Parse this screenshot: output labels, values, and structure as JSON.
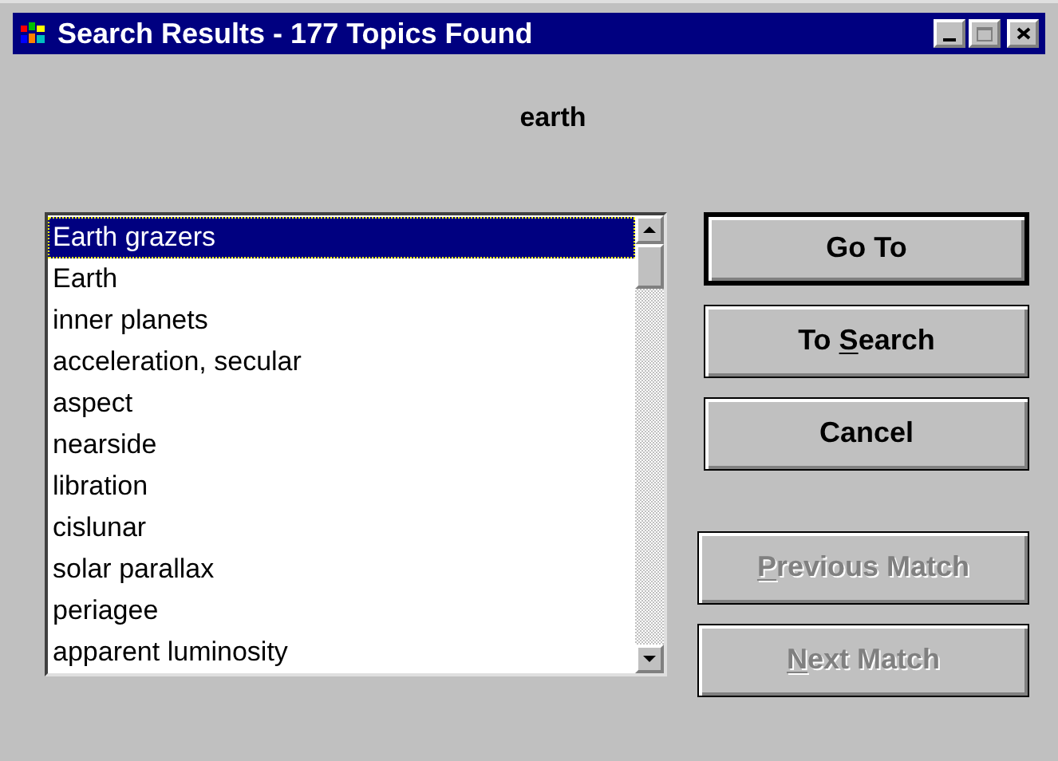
{
  "window": {
    "title": "Search Results - 177 Topics Found"
  },
  "query": "earth",
  "results": [
    {
      "label": "Earth grazers",
      "selected": true
    },
    {
      "label": "Earth",
      "selected": false
    },
    {
      "label": "inner planets",
      "selected": false
    },
    {
      "label": "acceleration, secular",
      "selected": false
    },
    {
      "label": "aspect",
      "selected": false
    },
    {
      "label": "nearside",
      "selected": false
    },
    {
      "label": "libration",
      "selected": false
    },
    {
      "label": "cislunar",
      "selected": false
    },
    {
      "label": "solar parallax",
      "selected": false
    },
    {
      "label": "periagee",
      "selected": false
    },
    {
      "label": "apparent luminosity",
      "selected": false
    }
  ],
  "buttons": [
    {
      "label_parts": [
        {
          "text": "Go To",
          "underline": false
        }
      ],
      "default": true,
      "disabled": false
    },
    {
      "label_parts": [
        {
          "text": "To ",
          "underline": false
        },
        {
          "text": "S",
          "underline": true
        },
        {
          "text": "earch",
          "underline": false
        }
      ],
      "default": false,
      "disabled": false
    },
    {
      "label_parts": [
        {
          "text": "Cancel",
          "underline": false
        }
      ],
      "default": false,
      "disabled": false
    },
    {
      "label_parts": [
        {
          "text": "P",
          "underline": true
        },
        {
          "text": "revious Match",
          "underline": false
        }
      ],
      "default": false,
      "disabled": true
    },
    {
      "label_parts": [
        {
          "text": "N",
          "underline": true
        },
        {
          "text": "ext Match",
          "underline": false
        }
      ],
      "default": false,
      "disabled": true
    }
  ]
}
